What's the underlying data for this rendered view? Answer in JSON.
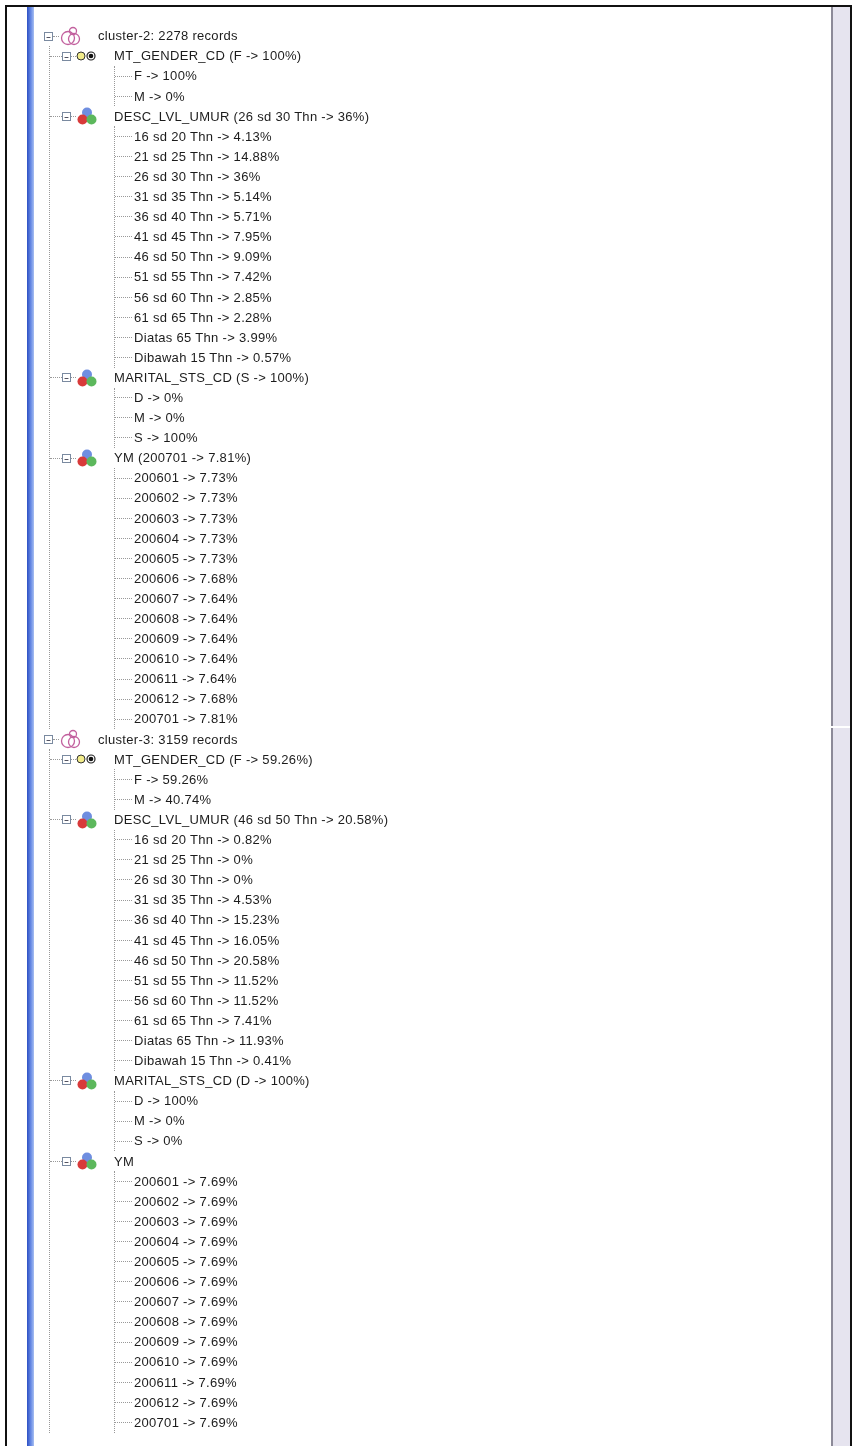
{
  "tree": [
    {
      "label": "cluster-2: 2278 records",
      "kind": "cluster",
      "expanded": true,
      "children": [
        {
          "label": "MT_GENDER_CD (F -> 100%)",
          "kind": "binary",
          "expanded": true,
          "children": [
            {
              "label": "F -> 100%"
            },
            {
              "label": "M -> 0%"
            }
          ]
        },
        {
          "label": "DESC_LVL_UMUR (26 sd 30 Thn -> 36%)",
          "kind": "nominal",
          "expanded": true,
          "children": [
            {
              "label": "16 sd 20 Thn -> 4.13%"
            },
            {
              "label": "21 sd 25 Thn -> 14.88%"
            },
            {
              "label": "26 sd 30 Thn -> 36%"
            },
            {
              "label": "31 sd 35 Thn -> 5.14%"
            },
            {
              "label": "36 sd 40 Thn -> 5.71%"
            },
            {
              "label": "41 sd 45 Thn -> 7.95%"
            },
            {
              "label": "46 sd 50 Thn -> 9.09%"
            },
            {
              "label": "51 sd 55 Thn -> 7.42%"
            },
            {
              "label": "56 sd 60 Thn -> 2.85%"
            },
            {
              "label": "61 sd 65 Thn -> 2.28%"
            },
            {
              "label": "Diatas 65 Thn -> 3.99%"
            },
            {
              "label": "Dibawah 15 Thn -> 0.57%"
            }
          ]
        },
        {
          "label": "MARITAL_STS_CD (S -> 100%)",
          "kind": "nominal",
          "expanded": true,
          "children": [
            {
              "label": "D -> 0%"
            },
            {
              "label": "M -> 0%"
            },
            {
              "label": "S -> 100%"
            }
          ]
        },
        {
          "label": "YM (200701 -> 7.81%)",
          "kind": "nominal",
          "expanded": true,
          "children": [
            {
              "label": "200601 -> 7.73%"
            },
            {
              "label": "200602 -> 7.73%"
            },
            {
              "label": "200603 -> 7.73%"
            },
            {
              "label": "200604 -> 7.73%"
            },
            {
              "label": "200605 -> 7.73%"
            },
            {
              "label": "200606 -> 7.68%"
            },
            {
              "label": "200607 -> 7.64%"
            },
            {
              "label": "200608 -> 7.64%"
            },
            {
              "label": "200609 -> 7.64%"
            },
            {
              "label": "200610 -> 7.64%"
            },
            {
              "label": "200611 -> 7.64%"
            },
            {
              "label": "200612 -> 7.68%"
            },
            {
              "label": "200701 -> 7.81%"
            }
          ]
        }
      ]
    },
    {
      "label": "cluster-3: 3159 records",
      "kind": "cluster",
      "expanded": true,
      "children": [
        {
          "label": "MT_GENDER_CD (F -> 59.26%)",
          "kind": "binary",
          "expanded": true,
          "children": [
            {
              "label": "F -> 59.26%"
            },
            {
              "label": "M -> 40.74%"
            }
          ]
        },
        {
          "label": "DESC_LVL_UMUR (46 sd 50 Thn -> 20.58%)",
          "kind": "nominal",
          "expanded": true,
          "children": [
            {
              "label": "16 sd 20 Thn -> 0.82%"
            },
            {
              "label": "21 sd 25 Thn -> 0%"
            },
            {
              "label": "26 sd 30 Thn -> 0%"
            },
            {
              "label": "31 sd 35 Thn -> 4.53%"
            },
            {
              "label": "36 sd 40 Thn -> 15.23%"
            },
            {
              "label": "41 sd 45 Thn -> 16.05%"
            },
            {
              "label": "46 sd 50 Thn -> 20.58%"
            },
            {
              "label": "51 sd 55 Thn -> 11.52%"
            },
            {
              "label": "56 sd 60 Thn -> 11.52%"
            },
            {
              "label": "61 sd 65 Thn -> 7.41%"
            },
            {
              "label": "Diatas 65 Thn -> 11.93%"
            },
            {
              "label": "Dibawah 15 Thn -> 0.41%"
            }
          ]
        },
        {
          "label": "MARITAL_STS_CD (D -> 100%)",
          "kind": "nominal",
          "expanded": true,
          "children": [
            {
              "label": "D -> 100%"
            },
            {
              "label": "M -> 0%"
            },
            {
              "label": "S -> 0%"
            }
          ]
        },
        {
          "label": "YM",
          "kind": "nominal",
          "expanded": true,
          "children": [
            {
              "label": "200601 -> 7.69%"
            },
            {
              "label": "200602 -> 7.69%"
            },
            {
              "label": "200603 -> 7.69%"
            },
            {
              "label": "200604 -> 7.69%"
            },
            {
              "label": "200605 -> 7.69%"
            },
            {
              "label": "200606 -> 7.69%"
            },
            {
              "label": "200607 -> 7.69%"
            },
            {
              "label": "200608 -> 7.69%"
            },
            {
              "label": "200609 -> 7.69%"
            },
            {
              "label": "200610 -> 7.69%"
            },
            {
              "label": "200611 -> 7.69%"
            },
            {
              "label": "200612 -> 7.69%"
            },
            {
              "label": "200701 -> 7.69%"
            }
          ]
        }
      ]
    }
  ]
}
